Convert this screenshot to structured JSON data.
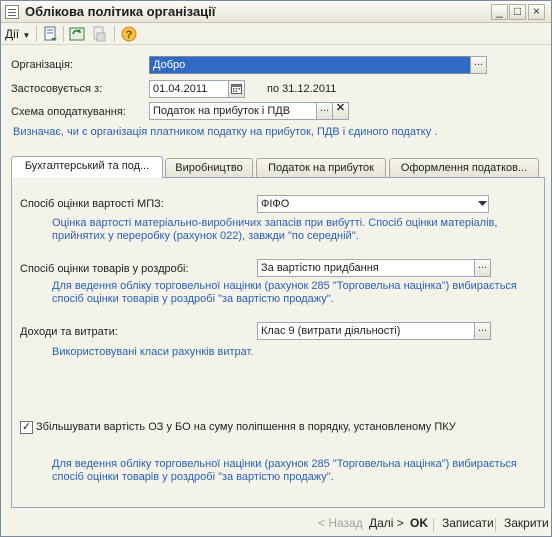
{
  "window": {
    "title": "Облікова політика організації"
  },
  "toolbar": {
    "actions_label": "Дії"
  },
  "form": {
    "organization_label": "Організація:",
    "organization_value": "Добро",
    "applied_from_label": "Застосовується з:",
    "applied_from_value": "01.04.2011",
    "applied_to_text": "по 31.12.2011",
    "tax_scheme_label": "Схема оподаткування:",
    "tax_scheme_value": "Податок на прибуток і ПДВ",
    "tax_scheme_hint": "Визначає, чи є організація платником податку на прибуток, ПДВ і єдиного податку ."
  },
  "tabs": [
    {
      "label": "Бухгалтерський та под..."
    },
    {
      "label": "Виробництво"
    },
    {
      "label": "Податок на прибуток"
    },
    {
      "label": "Оформлення податков..."
    }
  ],
  "accounting": {
    "mpz_label": "Спосіб оцінки вартості МПЗ:",
    "mpz_value": "ФІФО",
    "mpz_hint_line1": "Оцінка вартості матеріально-виробничих запасів при вибутті. Спосіб оцінки матеріалів,",
    "mpz_hint_line2": "прийнятих у переробку (рахунок 022), завжди \"по середній\".",
    "retail_label": "Спосіб оцінки товарів у роздробі:",
    "retail_value": "За вартістю придбання",
    "retail_hint_line1": "Для ведення обліку торговельної націнки (рахунок 285 \"Торговельна націнка\") вибирається",
    "retail_hint_line2": "спосіб оцінки товарів у роздробі \"за вартістю продажу\".",
    "income_label": "Доходи та витрати:",
    "income_value": "Клас 9 (витрати діяльності)",
    "income_hint": "Використовувані класи рахунків витрат.",
    "checkbox_label": "Збільшувати вартість ОЗ у БО на суму поліпшення в порядку, установленому ПКУ",
    "checkbox_checked": true,
    "bottom_hint_line1": "Для ведення обліку торговельної націнки (рахунок 285 \"Торговельна націнка\") вибирається",
    "bottom_hint_line2": "спосіб оцінки товарів у роздробі \"за вартістю продажу\"."
  },
  "footer": {
    "back_label": "< Назад",
    "next_label": "Далі >",
    "ok_label": "OK",
    "save_label": "Записати",
    "close_label": "Закрити"
  },
  "colors": {
    "hint_blue": "#2b5fb5",
    "selection_blue": "#316ac5"
  }
}
